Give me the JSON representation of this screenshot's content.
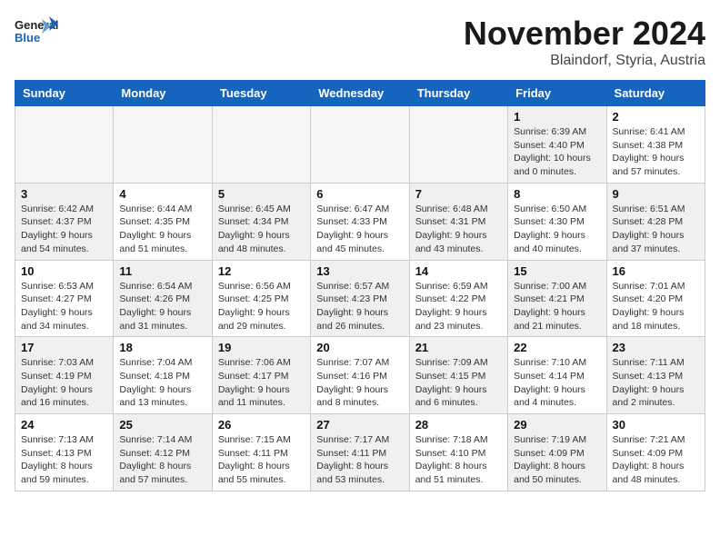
{
  "header": {
    "logo_general": "General",
    "logo_blue": "Blue",
    "month_title": "November 2024",
    "location": "Blaindorf, Styria, Austria"
  },
  "weekdays": [
    "Sunday",
    "Monday",
    "Tuesday",
    "Wednesday",
    "Thursday",
    "Friday",
    "Saturday"
  ],
  "weeks": [
    [
      {
        "day": "",
        "info": "",
        "empty": true
      },
      {
        "day": "",
        "info": "",
        "empty": true
      },
      {
        "day": "",
        "info": "",
        "empty": true
      },
      {
        "day": "",
        "info": "",
        "empty": true
      },
      {
        "day": "",
        "info": "",
        "empty": true
      },
      {
        "day": "1",
        "info": "Sunrise: 6:39 AM\nSunset: 4:40 PM\nDaylight: 10 hours and 0 minutes.",
        "shaded": true
      },
      {
        "day": "2",
        "info": "Sunrise: 6:41 AM\nSunset: 4:38 PM\nDaylight: 9 hours and 57 minutes.",
        "shaded": false
      }
    ],
    [
      {
        "day": "3",
        "info": "Sunrise: 6:42 AM\nSunset: 4:37 PM\nDaylight: 9 hours and 54 minutes.",
        "shaded": true
      },
      {
        "day": "4",
        "info": "Sunrise: 6:44 AM\nSunset: 4:35 PM\nDaylight: 9 hours and 51 minutes.",
        "shaded": false
      },
      {
        "day": "5",
        "info": "Sunrise: 6:45 AM\nSunset: 4:34 PM\nDaylight: 9 hours and 48 minutes.",
        "shaded": true
      },
      {
        "day": "6",
        "info": "Sunrise: 6:47 AM\nSunset: 4:33 PM\nDaylight: 9 hours and 45 minutes.",
        "shaded": false
      },
      {
        "day": "7",
        "info": "Sunrise: 6:48 AM\nSunset: 4:31 PM\nDaylight: 9 hours and 43 minutes.",
        "shaded": true
      },
      {
        "day": "8",
        "info": "Sunrise: 6:50 AM\nSunset: 4:30 PM\nDaylight: 9 hours and 40 minutes.",
        "shaded": false
      },
      {
        "day": "9",
        "info": "Sunrise: 6:51 AM\nSunset: 4:28 PM\nDaylight: 9 hours and 37 minutes.",
        "shaded": true
      }
    ],
    [
      {
        "day": "10",
        "info": "Sunrise: 6:53 AM\nSunset: 4:27 PM\nDaylight: 9 hours and 34 minutes.",
        "shaded": false
      },
      {
        "day": "11",
        "info": "Sunrise: 6:54 AM\nSunset: 4:26 PM\nDaylight: 9 hours and 31 minutes.",
        "shaded": true
      },
      {
        "day": "12",
        "info": "Sunrise: 6:56 AM\nSunset: 4:25 PM\nDaylight: 9 hours and 29 minutes.",
        "shaded": false
      },
      {
        "day": "13",
        "info": "Sunrise: 6:57 AM\nSunset: 4:23 PM\nDaylight: 9 hours and 26 minutes.",
        "shaded": true
      },
      {
        "day": "14",
        "info": "Sunrise: 6:59 AM\nSunset: 4:22 PM\nDaylight: 9 hours and 23 minutes.",
        "shaded": false
      },
      {
        "day": "15",
        "info": "Sunrise: 7:00 AM\nSunset: 4:21 PM\nDaylight: 9 hours and 21 minutes.",
        "shaded": true
      },
      {
        "day": "16",
        "info": "Sunrise: 7:01 AM\nSunset: 4:20 PM\nDaylight: 9 hours and 18 minutes.",
        "shaded": false
      }
    ],
    [
      {
        "day": "17",
        "info": "Sunrise: 7:03 AM\nSunset: 4:19 PM\nDaylight: 9 hours and 16 minutes.",
        "shaded": true
      },
      {
        "day": "18",
        "info": "Sunrise: 7:04 AM\nSunset: 4:18 PM\nDaylight: 9 hours and 13 minutes.",
        "shaded": false
      },
      {
        "day": "19",
        "info": "Sunrise: 7:06 AM\nSunset: 4:17 PM\nDaylight: 9 hours and 11 minutes.",
        "shaded": true
      },
      {
        "day": "20",
        "info": "Sunrise: 7:07 AM\nSunset: 4:16 PM\nDaylight: 9 hours and 8 minutes.",
        "shaded": false
      },
      {
        "day": "21",
        "info": "Sunrise: 7:09 AM\nSunset: 4:15 PM\nDaylight: 9 hours and 6 minutes.",
        "shaded": true
      },
      {
        "day": "22",
        "info": "Sunrise: 7:10 AM\nSunset: 4:14 PM\nDaylight: 9 hours and 4 minutes.",
        "shaded": false
      },
      {
        "day": "23",
        "info": "Sunrise: 7:11 AM\nSunset: 4:13 PM\nDaylight: 9 hours and 2 minutes.",
        "shaded": true
      }
    ],
    [
      {
        "day": "24",
        "info": "Sunrise: 7:13 AM\nSunset: 4:13 PM\nDaylight: 8 hours and 59 minutes.",
        "shaded": false
      },
      {
        "day": "25",
        "info": "Sunrise: 7:14 AM\nSunset: 4:12 PM\nDaylight: 8 hours and 57 minutes.",
        "shaded": true
      },
      {
        "day": "26",
        "info": "Sunrise: 7:15 AM\nSunset: 4:11 PM\nDaylight: 8 hours and 55 minutes.",
        "shaded": false
      },
      {
        "day": "27",
        "info": "Sunrise: 7:17 AM\nSunset: 4:11 PM\nDaylight: 8 hours and 53 minutes.",
        "shaded": true
      },
      {
        "day": "28",
        "info": "Sunrise: 7:18 AM\nSunset: 4:10 PM\nDaylight: 8 hours and 51 minutes.",
        "shaded": false
      },
      {
        "day": "29",
        "info": "Sunrise: 7:19 AM\nSunset: 4:09 PM\nDaylight: 8 hours and 50 minutes.",
        "shaded": true
      },
      {
        "day": "30",
        "info": "Sunrise: 7:21 AM\nSunset: 4:09 PM\nDaylight: 8 hours and 48 minutes.",
        "shaded": false
      }
    ]
  ]
}
